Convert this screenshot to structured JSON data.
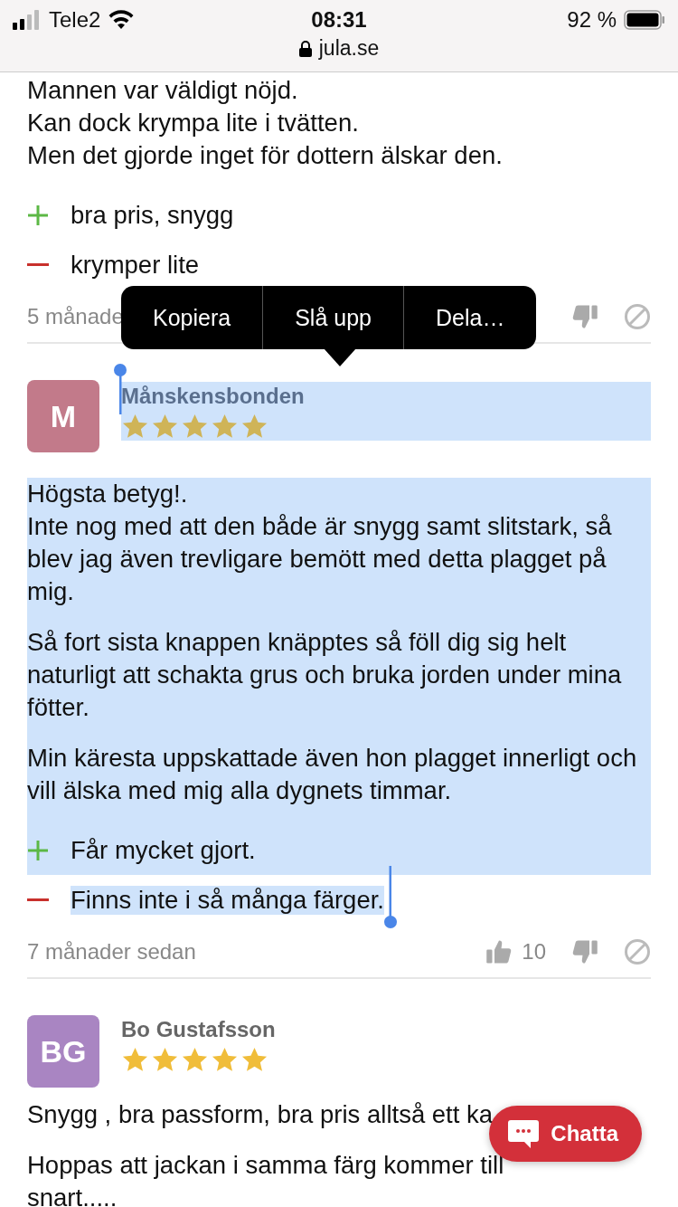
{
  "status_bar": {
    "carrier": "Tele2",
    "time": "08:31",
    "battery": "92 %",
    "url": "jula.se"
  },
  "reviews": [
    {
      "paragraphs": [
        "Mannen var väldigt nöjd.\nKan dock krympa lite i tvätten.\nMen det gjorde inget för dottern älskar den."
      ],
      "pros": [
        "bra pris, snygg"
      ],
      "cons": [
        "krymper lite"
      ],
      "age": "5 månade",
      "selected": false
    },
    {
      "initials": "M",
      "color": "#c27a8a",
      "name": "Månskensbonden",
      "stars": 5,
      "paragraphs": [
        "Högsta betyg!.\nInte nog med att den både är snygg samt slitstark, så blev jag även trevligare bemött med detta plagget på mig.",
        "Så fort sista knappen knäpptes så föll dig sig helt naturligt att schakta grus och bruka jorden under mina fötter.",
        "Min käresta uppskattade även hon plagget innerligt och vill älska med mig alla dygnets timmar."
      ],
      "pros": [
        "Får mycket gjort."
      ],
      "cons": [
        "Finns inte i så många färger."
      ],
      "age": "7 månader sedan",
      "likes": "10",
      "selected": true
    },
    {
      "initials": "BG",
      "color": "#a985c2",
      "name": "Bo Gustafsson",
      "stars": 5,
      "paragraphs": [
        "Snygg , bra passform, bra pris alltså ett ka",
        "Hoppas att jackan i samma färg kommer till\nsnart....."
      ],
      "selected": false
    }
  ],
  "context_menu": [
    "Kopiera",
    "Slå upp",
    "Dela…"
  ],
  "chat_button": "Chatta"
}
